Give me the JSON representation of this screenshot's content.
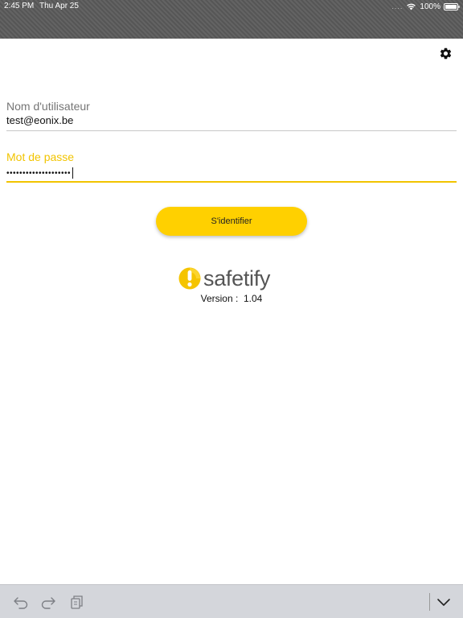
{
  "status_bar": {
    "time": "2:45 PM",
    "date": "Thu Apr 25",
    "signal": "....",
    "battery": "100%",
    "icons": [
      "wifi-icon",
      "battery-icon"
    ]
  },
  "header": {
    "settings_icon": "gear-icon"
  },
  "form": {
    "username": {
      "label": "Nom d'utilisateur",
      "value": "test@eonix.be"
    },
    "password": {
      "label": "Mot de passe",
      "masked_value": "••••••••••••••••••••"
    },
    "submit_label": "S'identifier"
  },
  "branding": {
    "logo_text": "safetify",
    "version_label": "Version :",
    "version_value": "1.04"
  },
  "keyboard_bar": {
    "icons": [
      "undo-icon",
      "redo-icon",
      "paste-icon",
      "chevron-down-icon"
    ]
  },
  "colors": {
    "accent": "#ffd000",
    "header": "#5b5b5b",
    "focused_label": "#f2c400"
  }
}
